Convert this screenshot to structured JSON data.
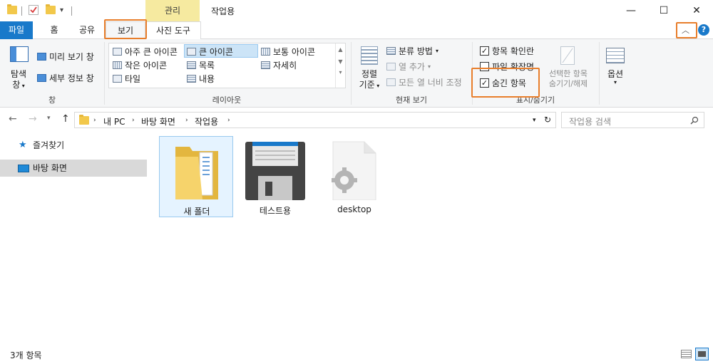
{
  "titlebar": {
    "contextual_tab": "관리",
    "window_title": "작업용",
    "minimize": "—",
    "maximize": "☐",
    "close": "✕"
  },
  "tabs": {
    "file": "파일",
    "home": "홈",
    "share": "공유",
    "view": "보기",
    "photo_tools": "사진 도구"
  },
  "ribbon": {
    "pane_group": {
      "nav_pane_line1": "탐색",
      "nav_pane_line2": "창",
      "preview_pane": "미리 보기 창",
      "details_pane": "세부 정보 창",
      "label": "창"
    },
    "layout_group": {
      "items": [
        "아주 큰 아이콘",
        "큰 아이콘",
        "보통 아이콘",
        "작은 아이콘",
        "목록",
        "자세히",
        "타일",
        "내용"
      ],
      "selected": "큰 아이콘",
      "label": "레이아웃"
    },
    "current_view_group": {
      "sort_line1": "정렬",
      "sort_line2": "기준",
      "group_by": "분류 방법",
      "add_columns": "열 추가",
      "size_columns": "모든 열 너비 조정",
      "label": "현재 보기"
    },
    "show_hide_group": {
      "item_checkboxes": "항목 확인란",
      "item_checkboxes_checked": true,
      "file_extensions": "파일 확장명",
      "file_extensions_checked": false,
      "hidden_items": "숨긴 항목",
      "hidden_items_checked": true,
      "hide_selected_line1": "선택한 항목",
      "hide_selected_line2": "숨기기/해제",
      "label": "표시/숨기기"
    },
    "options": "옵션"
  },
  "address": {
    "breadcrumb": [
      "내 PC",
      "바탕 화면",
      "작업용"
    ],
    "search_placeholder": "작업용 검색"
  },
  "nav_pane": {
    "items": [
      "즐겨찾기",
      "바탕 화면"
    ],
    "selected": "바탕 화면"
  },
  "files": [
    {
      "name": "새 폴더",
      "type": "folder"
    },
    {
      "name": "테스트용",
      "type": "save-disk"
    },
    {
      "name": "desktop",
      "type": "settings-file"
    }
  ],
  "status": {
    "item_count": "3개 항목"
  },
  "colors": {
    "file_tab": "#1979ca",
    "highlight": "#e87e2b",
    "contextual": "#f6eaa0",
    "selection": "#cce4f7"
  }
}
